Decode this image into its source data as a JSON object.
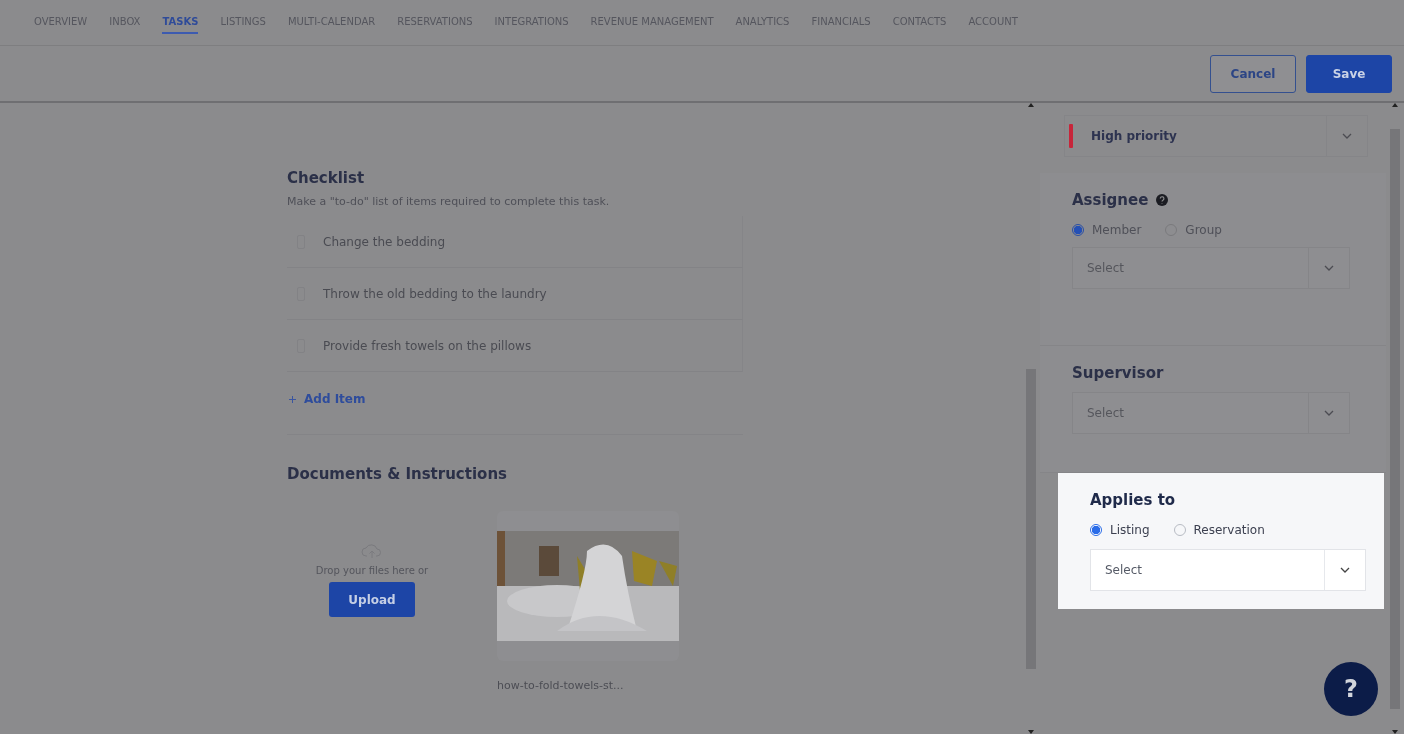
{
  "nav": {
    "tabs": [
      {
        "label": "OVERVIEW",
        "selected": false
      },
      {
        "label": "INBOX",
        "selected": false
      },
      {
        "label": "TASKS",
        "selected": true
      },
      {
        "label": "LISTINGS",
        "selected": false
      },
      {
        "label": "MULTI-CALENDAR",
        "selected": false
      },
      {
        "label": "RESERVATIONS",
        "selected": false
      },
      {
        "label": "INTEGRATIONS",
        "selected": false
      },
      {
        "label": "REVENUE MANAGEMENT",
        "selected": false
      },
      {
        "label": "ANALYTICS",
        "selected": false
      },
      {
        "label": "FINANCIALS",
        "selected": false
      },
      {
        "label": "CONTACTS",
        "selected": false
      },
      {
        "label": "ACCOUNT",
        "selected": false
      }
    ]
  },
  "actions": {
    "cancel": "Cancel",
    "save": "Save"
  },
  "checklist": {
    "title": "Checklist",
    "description": "Make a \"to-do\" list of items required to complete this task.",
    "items": [
      {
        "text": "Change the bedding"
      },
      {
        "text": "Throw the old bedding to the laundry"
      },
      {
        "text": "Provide fresh towels on the pillows"
      }
    ],
    "add_item": "Add Item"
  },
  "documents": {
    "title": "Documents & Instructions",
    "drop_text": "Drop your files here or",
    "upload": "Upload",
    "file": {
      "name": "how-to-fold-towels-st...",
      "kind": "picture"
    }
  },
  "sidebar": {
    "priority": {
      "label": "High priority"
    },
    "assignee": {
      "title": "Assignee",
      "highlighted": false,
      "options": [
        {
          "label": "Member",
          "selected": true
        },
        {
          "label": "Group",
          "selected": false
        }
      ],
      "select": {
        "placeholder": "Select"
      }
    },
    "supervisor": {
      "title": "Supervisor",
      "highlighted": false,
      "select": {
        "placeholder": "Select"
      }
    },
    "applies_to": {
      "title": "Applies to",
      "highlighted": true,
      "options": [
        {
          "label": "Listing",
          "selected": true
        },
        {
          "label": "Reservation",
          "selected": false
        }
      ],
      "select": {
        "placeholder": "Select"
      }
    }
  },
  "help": {
    "label": "?"
  }
}
